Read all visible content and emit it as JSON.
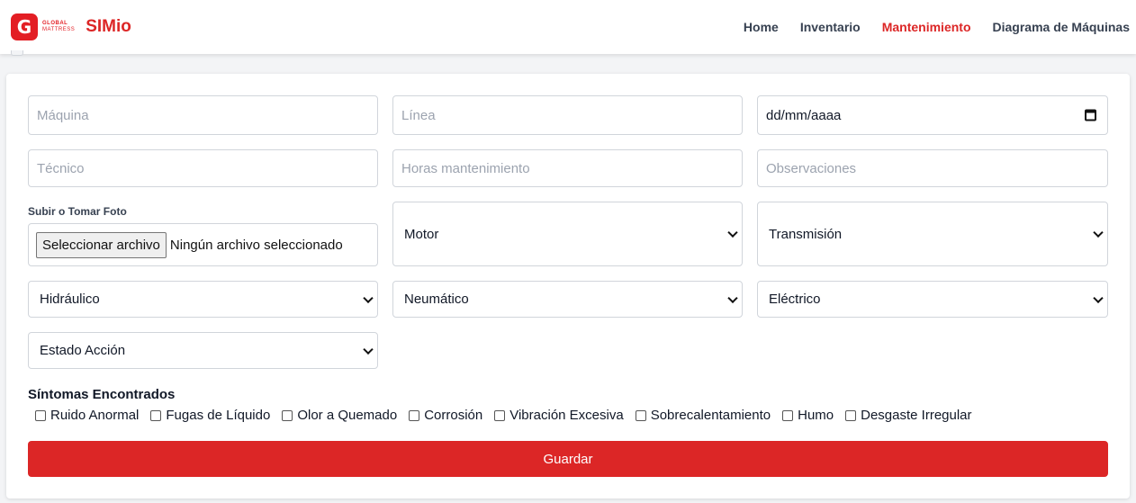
{
  "brand": {
    "logo_glyph": "G",
    "logo_line1": "GLOBAL",
    "logo_line2": "MATTRESS",
    "app_name": "SIMio",
    "accent": "#dc2626"
  },
  "nav": {
    "items": [
      {
        "label": "Home",
        "active": false
      },
      {
        "label": "Inventario",
        "active": false
      },
      {
        "label": "Mantenimiento",
        "active": true
      },
      {
        "label": "Diagrama de Máquinas",
        "active": false
      }
    ]
  },
  "form": {
    "maquina_placeholder": "Máquina",
    "linea_placeholder": "Línea",
    "fecha_value": "dd/mm/aaaa",
    "tecnico_placeholder": "Técnico",
    "horas_placeholder": "Horas mantenimiento",
    "observaciones_placeholder": "Observaciones",
    "upload_label": "Subir o Tomar Foto",
    "file_button_label": "Seleccionar archivo",
    "file_status": "Ningún archivo seleccionado",
    "selects": {
      "motor": "Motor",
      "transmision": "Transmisión",
      "hidraulico": "Hidráulico",
      "neumatico": "Neumático",
      "electrico": "Eléctrico",
      "estado_accion": "Estado Acción"
    },
    "symptoms_title": "Síntomas Encontrados",
    "symptoms": [
      "Ruido Anormal",
      "Fugas de Líquido",
      "Olor a Quemado",
      "Corrosión",
      "Vibración Excesiva",
      "Sobrecalentamiento",
      "Humo",
      "Desgaste Irregular"
    ],
    "save_label": "Guardar"
  }
}
